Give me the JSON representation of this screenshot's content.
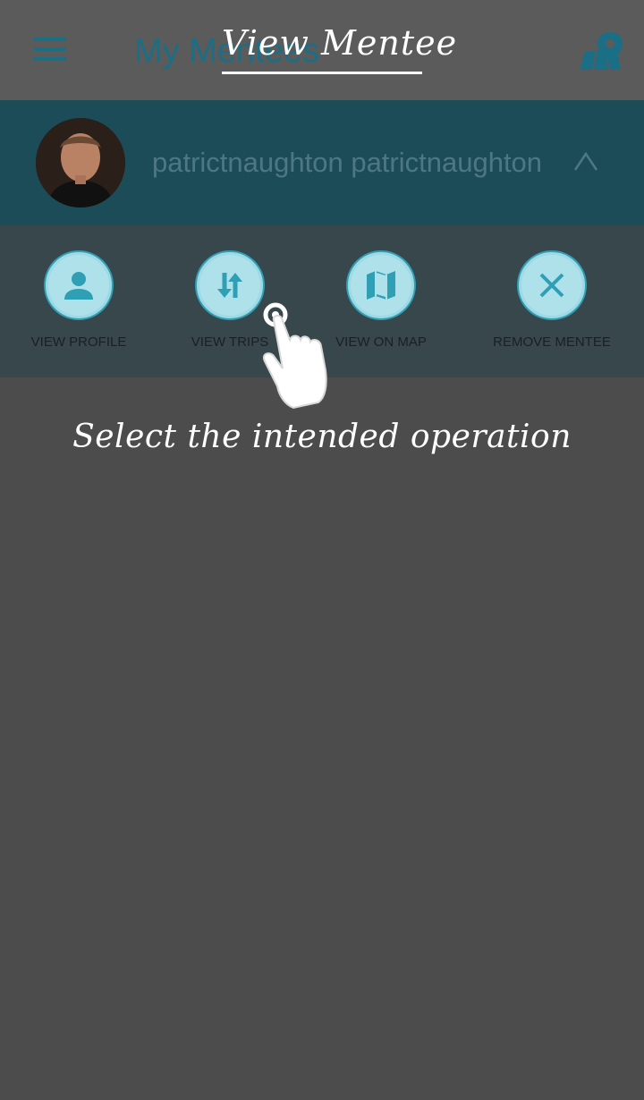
{
  "header": {
    "title": "My Mentees",
    "overlay_title": "View Mentee",
    "menu_icon": "hamburger-menu-icon",
    "map_icon": "map-pin-icon"
  },
  "mentee": {
    "name": "patrictnaughton patrictnaughton",
    "avatar": "mentee-avatar-photo",
    "expand_icon": "chevron-up-icon"
  },
  "actions": [
    {
      "label": "VIEW PROFILE",
      "icon": "person-icon"
    },
    {
      "label": "VIEW TRIPS",
      "icon": "swap-vertical-arrows-icon"
    },
    {
      "label": "VIEW ON MAP",
      "icon": "folded-map-icon"
    },
    {
      "label": "REMOVE MENTEE",
      "icon": "close-icon"
    }
  ],
  "tutorial": {
    "instruction": "Select the intended operation",
    "pointer_icon": "tap-hand-icon"
  },
  "colors": {
    "accent": "#2f9fb5",
    "icon_fill": "#aee1ea",
    "header_text": "#1a6e85",
    "overlay_text": "#ffffff"
  }
}
